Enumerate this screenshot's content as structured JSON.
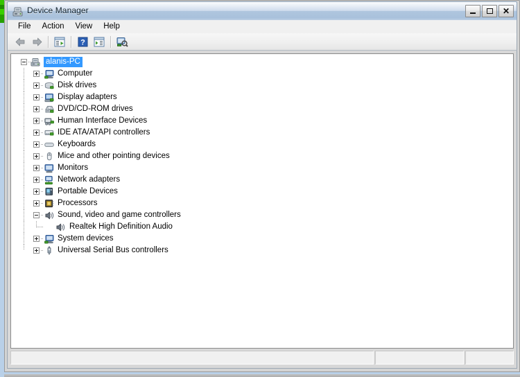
{
  "window": {
    "title": "Device Manager",
    "icon": "device-manager-icon",
    "controls": {
      "minimize": "_",
      "maximize": "□",
      "close": "✕"
    }
  },
  "menubar": {
    "items": [
      {
        "label": "File"
      },
      {
        "label": "Action"
      },
      {
        "label": "View"
      },
      {
        "label": "Help"
      }
    ]
  },
  "toolbar": {
    "items": [
      {
        "name": "back-arrow-icon",
        "title": "Back"
      },
      {
        "name": "forward-arrow-icon",
        "title": "Forward"
      },
      {
        "name": "separator-1",
        "title": ""
      },
      {
        "name": "properties-icon",
        "title": "Properties"
      },
      {
        "name": "separator-2",
        "title": ""
      },
      {
        "name": "help-icon",
        "title": "Help"
      },
      {
        "name": "show-hide-console-tree-icon",
        "title": "Show/Hide Console Tree"
      },
      {
        "name": "separator-3",
        "title": ""
      },
      {
        "name": "scan-for-hardware-changes-icon",
        "title": "Scan for hardware changes"
      }
    ]
  },
  "tree": {
    "root": {
      "label": "alanis-PC",
      "icon": "computer-root-icon",
      "expanded": true,
      "selected": true
    },
    "nodes": [
      {
        "label": "Computer",
        "icon": "computer-icon",
        "expandable": true,
        "expanded": false,
        "level": 1
      },
      {
        "label": "Disk drives",
        "icon": "disk-drive-icon",
        "expandable": true,
        "expanded": false,
        "level": 1
      },
      {
        "label": "Display adapters",
        "icon": "display-adapter-icon",
        "expandable": true,
        "expanded": false,
        "level": 1
      },
      {
        "label": "DVD/CD-ROM drives",
        "icon": "dvd-drive-icon",
        "expandable": true,
        "expanded": false,
        "level": 1
      },
      {
        "label": "Human Interface Devices",
        "icon": "hid-icon",
        "expandable": true,
        "expanded": false,
        "level": 1
      },
      {
        "label": "IDE ATA/ATAPI controllers",
        "icon": "ide-controller-icon",
        "expandable": true,
        "expanded": false,
        "level": 1
      },
      {
        "label": "Keyboards",
        "icon": "keyboard-icon",
        "expandable": true,
        "expanded": false,
        "level": 1
      },
      {
        "label": "Mice and other pointing devices",
        "icon": "mouse-icon",
        "expandable": true,
        "expanded": false,
        "level": 1
      },
      {
        "label": "Monitors",
        "icon": "monitor-icon",
        "expandable": true,
        "expanded": false,
        "level": 1
      },
      {
        "label": "Network adapters",
        "icon": "network-adapter-icon",
        "expandable": true,
        "expanded": false,
        "level": 1
      },
      {
        "label": "Portable Devices",
        "icon": "portable-device-icon",
        "expandable": true,
        "expanded": false,
        "level": 1
      },
      {
        "label": "Processors",
        "icon": "processor-icon",
        "expandable": true,
        "expanded": false,
        "level": 1
      },
      {
        "label": "Sound, video and game controllers",
        "icon": "sound-controller-icon",
        "expandable": true,
        "expanded": true,
        "level": 1
      },
      {
        "label": "Realtek High Definition Audio",
        "icon": "speaker-icon",
        "expandable": false,
        "expanded": false,
        "level": 2
      },
      {
        "label": "System devices",
        "icon": "system-device-icon",
        "expandable": true,
        "expanded": false,
        "level": 1
      },
      {
        "label": "Universal Serial Bus controllers",
        "icon": "usb-controller-icon",
        "expandable": true,
        "expanded": false,
        "level": 1
      }
    ]
  },
  "statusbar": {
    "panes": [
      {
        "text": ""
      },
      {
        "text": ""
      },
      {
        "text": ""
      }
    ]
  },
  "colors": {
    "selection": "#3399ff",
    "titlebar": "#a9c1dc",
    "window_bg": "#d8d8d8",
    "tree_bg": "#ffffff",
    "desktop": "#2fb200"
  }
}
